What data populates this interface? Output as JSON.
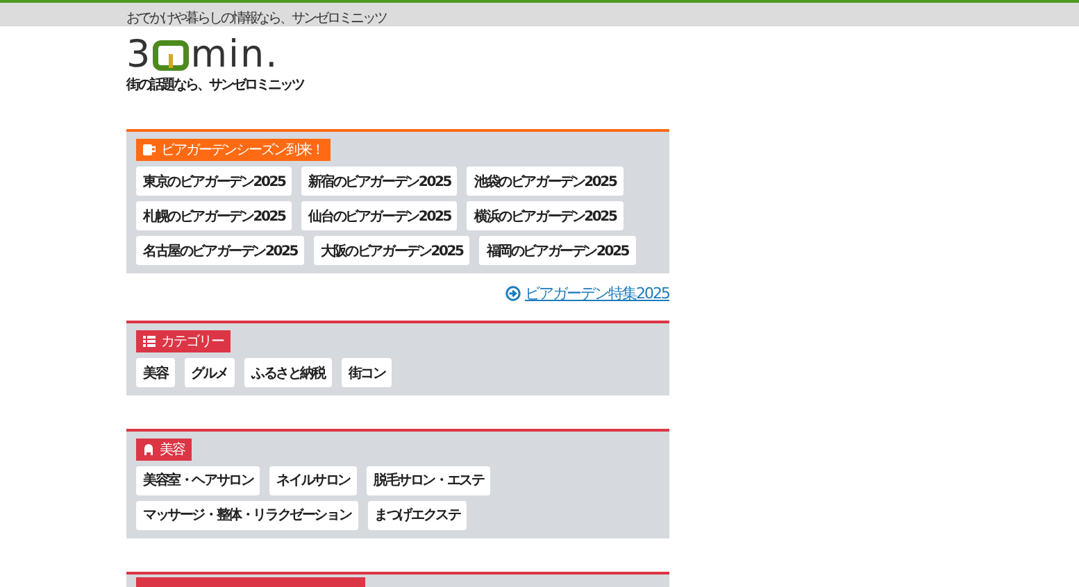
{
  "top_bar": {
    "text": "おでかけや暮らしの情報なら、サンゼロミニッツ"
  },
  "logo": {
    "lead": "3",
    "tail": "min.",
    "tagline": "街の話題なら、サンゼロミニッツ"
  },
  "sections": [
    {
      "title": "ビアガーデンシーズン到来！",
      "kind": "cup",
      "color": "#ff6a13",
      "items": [
        "東京のビアガーデン2025",
        "新宿のビアガーデン2025",
        "池袋のビアガーデン2025",
        "札幌のビアガーデン2025",
        "仙台のビアガーデン2025",
        "横浜のビアガーデン2025",
        "名古屋のビアガーデン2025",
        "大阪のビアガーデン2025",
        "福岡のビアガーデン2025"
      ],
      "link": "ビアガーデン特集2025"
    },
    {
      "title": "カテゴリー",
      "kind": "list",
      "color": "#dc3545",
      "items": [
        "美容",
        "グルメ",
        "ふるさと納税",
        "街コン"
      ]
    },
    {
      "title": "美容",
      "kind": "person",
      "color": "#dc3545",
      "items": [
        "美容室・ヘアサロン",
        "ネイルサロン",
        "脱毛サロン・エステ",
        "マッサージ・整体・リラクゼーション",
        "まつげエクステ"
      ]
    },
    {
      "color": "#dc3545"
    }
  ]
}
